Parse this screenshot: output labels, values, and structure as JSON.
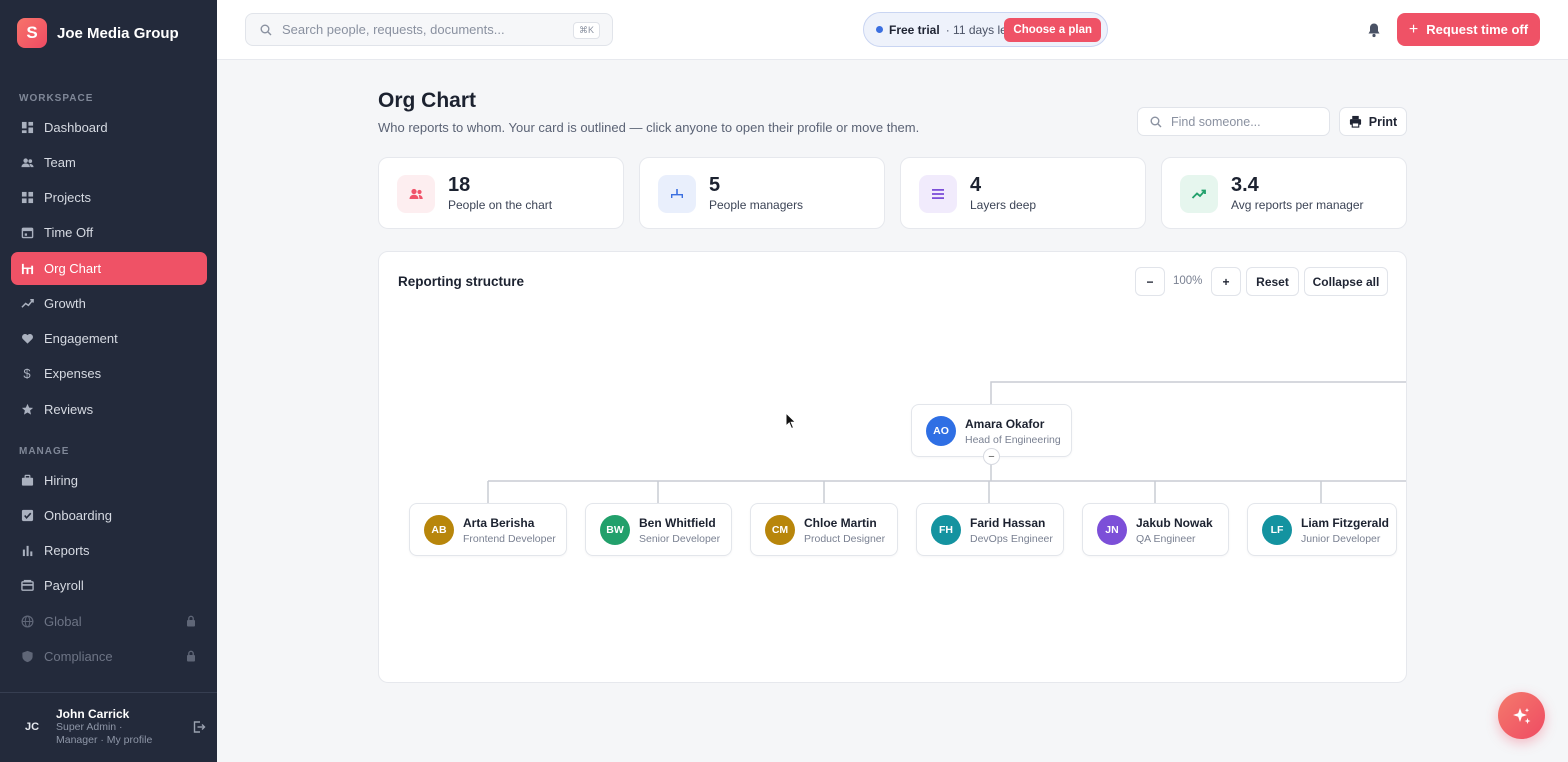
{
  "brand": {
    "logo_letter": "S",
    "name": "Joe Media Group"
  },
  "sidebar": {
    "workspace_label": "WORKSPACE",
    "manage_label": "MANAGE",
    "workspace_items": [
      {
        "label": "Dashboard",
        "icon": "dashboard-icon"
      },
      {
        "label": "Team",
        "icon": "team-icon"
      },
      {
        "label": "Projects",
        "icon": "projects-icon"
      },
      {
        "label": "Time Off",
        "icon": "calendar-icon"
      },
      {
        "label": "Org Chart",
        "icon": "org-chart-icon",
        "active": true
      },
      {
        "label": "Growth",
        "icon": "growth-icon"
      },
      {
        "label": "Engagement",
        "icon": "heart-icon"
      },
      {
        "label": "Expenses",
        "icon": "dollar-icon"
      },
      {
        "label": "Reviews",
        "icon": "star-icon"
      }
    ],
    "manage_items": [
      {
        "label": "Hiring",
        "icon": "briefcase-icon"
      },
      {
        "label": "Onboarding",
        "icon": "checkbox-icon"
      },
      {
        "label": "Reports",
        "icon": "bar-chart-icon"
      },
      {
        "label": "Payroll",
        "icon": "payroll-icon"
      },
      {
        "label": "Global",
        "icon": "globe-icon",
        "locked": true
      },
      {
        "label": "Compliance",
        "icon": "shield-icon",
        "locked": true
      }
    ],
    "user": {
      "initials": "JC",
      "name": "John Carrick",
      "role": "Super Admin · Manager · My profile"
    }
  },
  "topbar": {
    "search_placeholder": "Search people, requests, documents...",
    "search_shortcut": "⌘K",
    "trial_label": "Free trial",
    "trial_days": "· 11 days left",
    "trial_button": "Choose a plan",
    "request_button": "Request time off"
  },
  "page": {
    "title": "Org Chart",
    "subtitle": "Who reports to whom. Your card is outlined — click anyone to open their profile or move them.",
    "find_placeholder": "Find someone...",
    "print_label": "Print"
  },
  "stats": [
    {
      "value": "18",
      "label": "People on the chart",
      "icon": "people-icon",
      "color": "#f0536a",
      "bg": "#fdeef0"
    },
    {
      "value": "5",
      "label": "People managers",
      "icon": "hierarchy-icon",
      "color": "#3b6fe0",
      "bg": "#e9effc"
    },
    {
      "value": "4",
      "label": "Layers deep",
      "icon": "layers-icon",
      "color": "#7c4fd8",
      "bg": "#f1ebfc"
    },
    {
      "value": "3.4",
      "label": "Avg reports per manager",
      "icon": "trend-up-icon",
      "color": "#22a06b",
      "bg": "#e6f6ee"
    }
  ],
  "panel": {
    "title": "Reporting structure",
    "zoom_out": "−",
    "zoom_level": "100%",
    "zoom_in": "+",
    "reset": "Reset",
    "collapse_all": "Collapse all",
    "collapse_toggle": "−"
  },
  "org": {
    "manager": {
      "initials": "AO",
      "name": "Amara Okafor",
      "role": "Head of Engineering",
      "color": "#2f6fe4"
    },
    "reports": [
      {
        "initials": "AB",
        "name": "Arta Berisha",
        "role": "Frontend Developer",
        "color": "#b8860b"
      },
      {
        "initials": "BW",
        "name": "Ben Whitfield",
        "role": "Senior Developer",
        "color": "#22a06b"
      },
      {
        "initials": "CM",
        "name": "Chloe Martin",
        "role": "Product Designer",
        "color": "#b8860b"
      },
      {
        "initials": "FH",
        "name": "Farid Hassan",
        "role": "DevOps Engineer",
        "color": "#1493a0"
      },
      {
        "initials": "JN",
        "name": "Jakub Nowak",
        "role": "QA Engineer",
        "color": "#7c4fd8"
      },
      {
        "initials": "LF",
        "name": "Liam Fitzgerald",
        "role": "Junior Developer",
        "color": "#1493a0"
      }
    ]
  }
}
